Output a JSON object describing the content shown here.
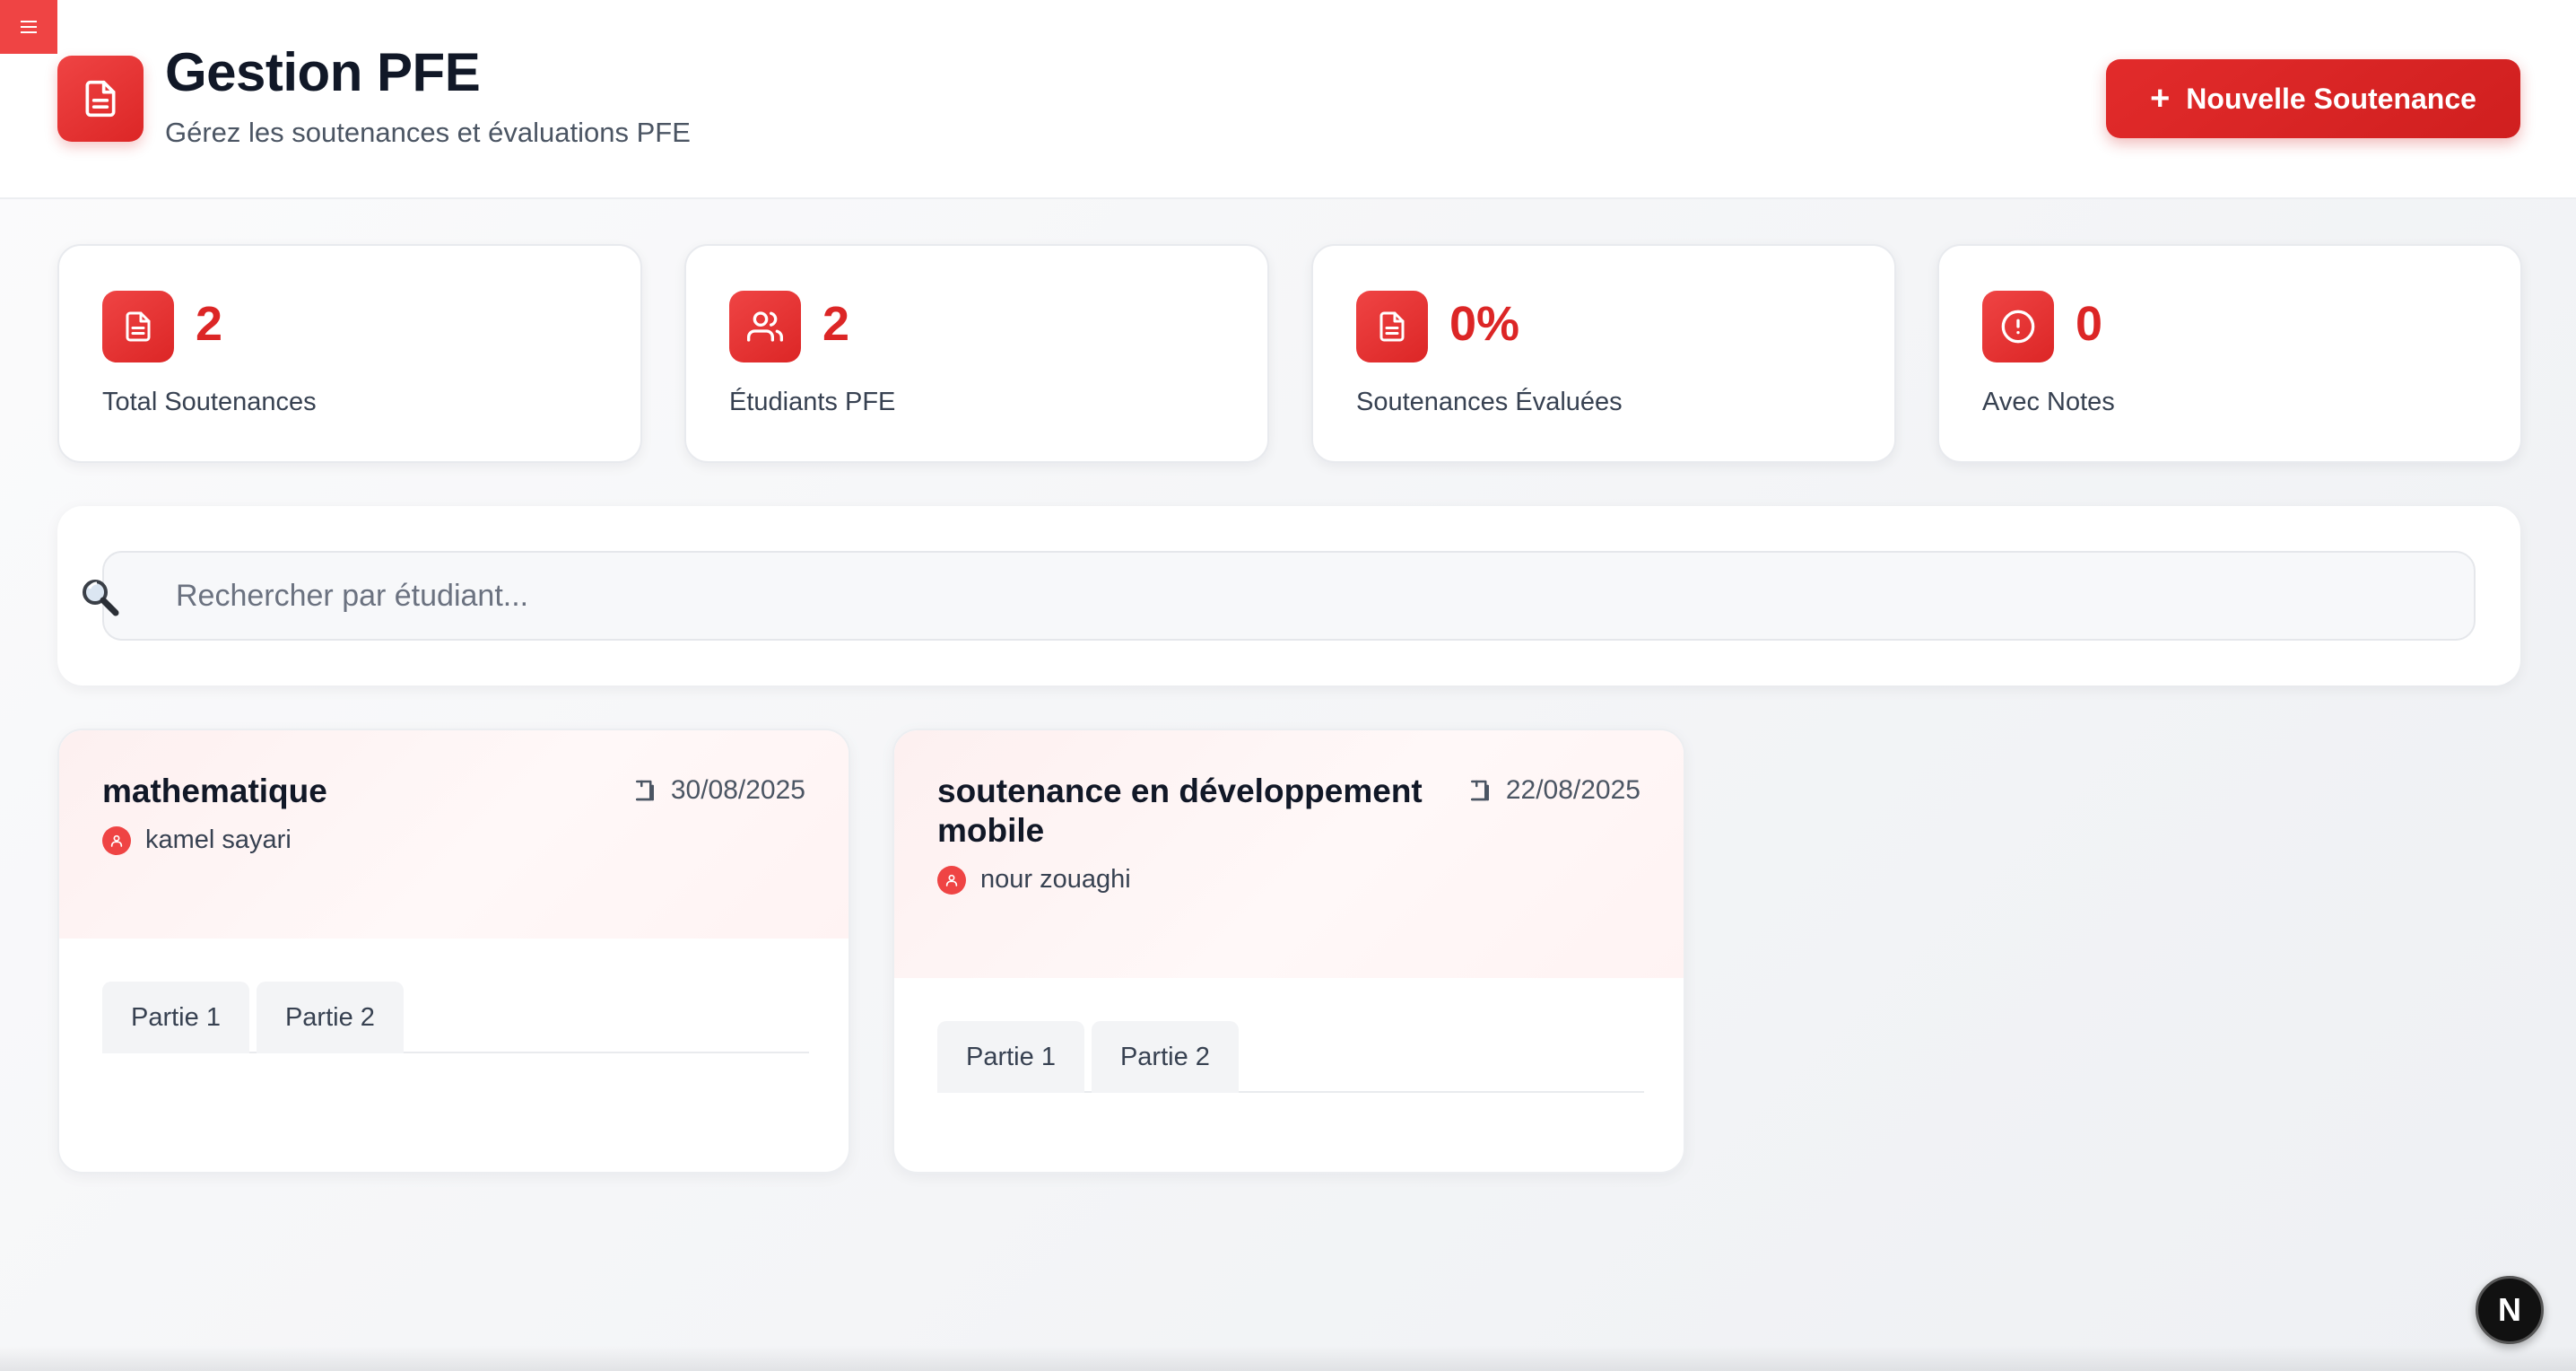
{
  "menu": {
    "icon": "hamburger-icon"
  },
  "header": {
    "icon": "document-icon",
    "title": "Gestion PFE",
    "subtitle": "Gérez les soutenances et évaluations PFE",
    "new_button_icon": "+",
    "new_button_label": "Nouvelle Soutenance"
  },
  "stats": [
    {
      "icon": "document-icon",
      "value": "2",
      "label": "Total Soutenances"
    },
    {
      "icon": "users-icon",
      "value": "2",
      "label": "Étudiants PFE"
    },
    {
      "icon": "document-icon",
      "value": "0%",
      "label": "Soutenances Évaluées"
    },
    {
      "icon": "alert-circle-icon",
      "value": "0",
      "label": "Avec Notes"
    }
  ],
  "search": {
    "icon": "search-icon",
    "placeholder": "Rechercher par étudiant...",
    "value": ""
  },
  "soutenances": [
    {
      "title": "mathematique",
      "date": "30/08/2025",
      "student": "kamel sayari",
      "tabs": [
        "Partie 1",
        "Partie 2"
      ]
    },
    {
      "title": "soutenance en développement mobile",
      "date": "22/08/2025",
      "student": "nour zouaghi",
      "tabs": [
        "Partie 1",
        "Partie 2"
      ]
    }
  ],
  "colors": {
    "accent": "#dc2626",
    "accent_light": "#ef4444"
  },
  "dev_badge": {
    "letter": "N"
  }
}
